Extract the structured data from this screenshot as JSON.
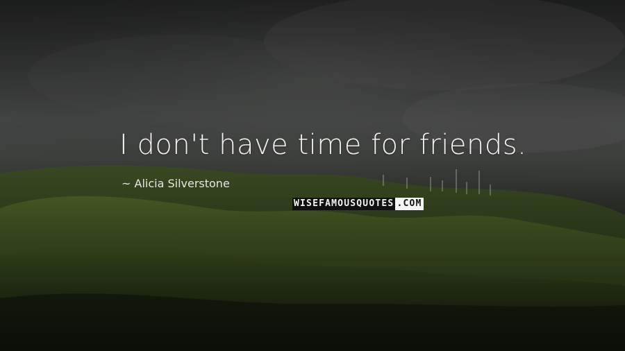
{
  "quote": {
    "text": "I don't have time for friends.",
    "author": "Alicia Silverstone"
  },
  "watermark": {
    "part1": "WISEFAMOUSQUOTES",
    "part2": ".COM"
  },
  "colors": {
    "text": "#f2f2f0",
    "sky": "#3a3c3b",
    "hills": "#2f3d1c"
  }
}
